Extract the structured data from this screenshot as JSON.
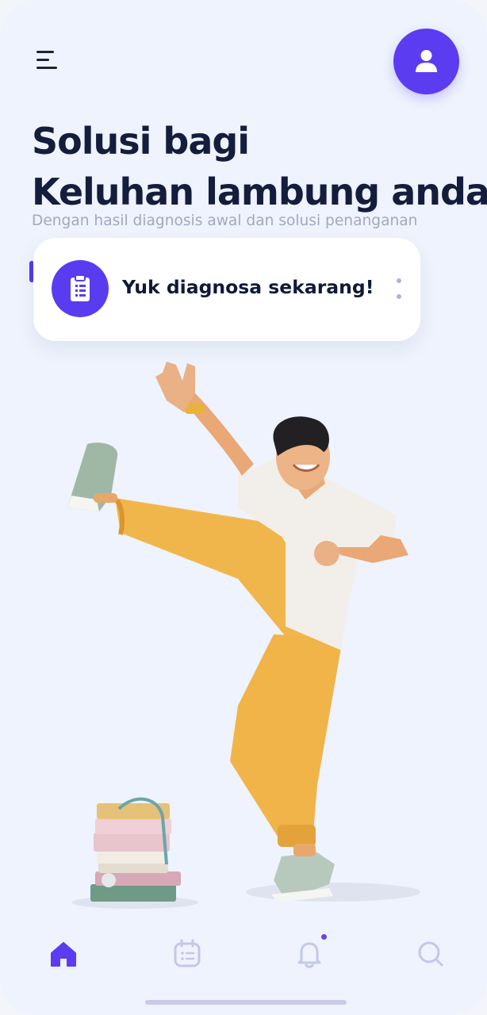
{
  "header": {
    "menu_icon": "hamburger-menu-icon",
    "profile_icon": "user-icon",
    "accent_color": "#5b3cf0"
  },
  "hero": {
    "title_line1": "Solusi bagi",
    "title_line2": "Keluhan lambung anda",
    "subtitle": "Dengan hasil diagnosis awal dan solusi penanganan"
  },
  "cta_card": {
    "icon": "clipboard-icon",
    "label": "Yuk diagnosa sekarang!",
    "more_icon": "vertical-dots-icon"
  },
  "illustration": {
    "description_icon": "dancing-person-with-books-illustration"
  },
  "bottom_nav": {
    "items": [
      {
        "icon": "home-icon",
        "active": true
      },
      {
        "icon": "calendar-icon",
        "active": false
      },
      {
        "icon": "bell-icon",
        "active": false,
        "has_badge": true
      },
      {
        "icon": "search-icon",
        "active": false
      }
    ],
    "active_color": "#5b3cf0",
    "inactive_color": "#c3c8e8"
  }
}
